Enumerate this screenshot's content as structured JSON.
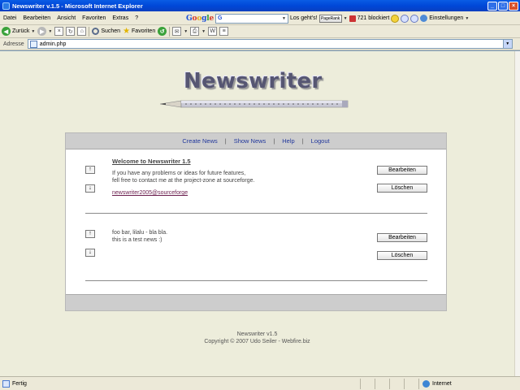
{
  "window": {
    "title": "Newswriter v.1.5 - Microsoft Internet Explorer"
  },
  "menu": {
    "items": [
      "Datei",
      "Bearbeiten",
      "Ansicht",
      "Favoriten",
      "Extras",
      "?"
    ]
  },
  "google_toolbar": {
    "logo": [
      "G",
      "o",
      "o",
      "g",
      "l",
      "e"
    ],
    "input_value": "G",
    "go_label": "Los geht's!",
    "pagerank_label": "PageRank",
    "blocked_label": "721 blockiert",
    "settings_label": "Einstellungen"
  },
  "toolbar": {
    "back_label": "Zurück",
    "search_label": "Suchen",
    "favorites_label": "Favoriten"
  },
  "address": {
    "label": "Adresse",
    "value": "admin.php"
  },
  "page": {
    "logo_text": "Newswriter",
    "nav": {
      "create_news": "Create News",
      "show_news": "Show News",
      "help": "Help",
      "logout": "Logout",
      "separator": "|"
    },
    "news": [
      {
        "title": "Welcome to Newswriter 1.5",
        "body": "If you have any problems or ideas for future features,\nfell free to contact me at the project-zone at sourceforge.",
        "link": "newswriter2005@sourceforge",
        "edit_label": "Bearbeiten",
        "delete_label": "Löschen",
        "up_label": "↑",
        "down_label": "↓"
      },
      {
        "title": "",
        "body": "foo bar, lilalu - bla bla.\nthis is a test news :)",
        "link": "",
        "edit_label": "Bearbeiten",
        "delete_label": "Löschen",
        "up_label": "↑",
        "down_label": "↓"
      }
    ],
    "footer_line1": "Newswriter v1.5",
    "footer_line2": "Copyright © 2007 Udo Seiler - Webfire.biz"
  },
  "statusbar": {
    "status": "Fertig",
    "zone": "Internet"
  }
}
